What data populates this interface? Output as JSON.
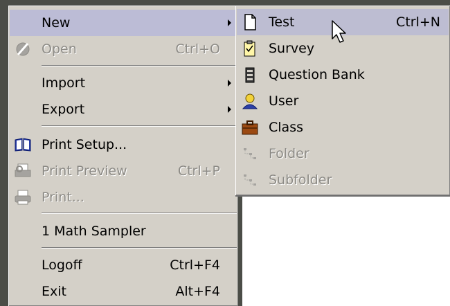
{
  "main_menu": {
    "new": {
      "label": "New"
    },
    "open": {
      "label": "Open",
      "shortcut": "Ctrl+O",
      "icon": "open-icon"
    },
    "import": {
      "label": "Import"
    },
    "export": {
      "label": "Export"
    },
    "print_setup": {
      "label": "Print Setup...",
      "icon": "book-icon"
    },
    "print_preview": {
      "label": "Print Preview",
      "shortcut": "Ctrl+P",
      "icon": "print-preview-icon"
    },
    "print": {
      "label": "Print...",
      "icon": "printer-icon"
    },
    "recent": {
      "label": "1 Math Sampler"
    },
    "logoff": {
      "label": "Logoff",
      "shortcut": "Ctrl+F4"
    },
    "exit": {
      "label": "Exit",
      "shortcut": "Alt+F4"
    }
  },
  "sub_menu": {
    "test": {
      "label": "Test",
      "shortcut": "Ctrl+N",
      "icon": "document-icon"
    },
    "survey": {
      "label": "Survey",
      "icon": "survey-icon"
    },
    "question_bank": {
      "label": "Question Bank",
      "icon": "question-bank-icon"
    },
    "user": {
      "label": "User",
      "icon": "user-icon"
    },
    "class": {
      "label": "Class",
      "icon": "briefcase-icon"
    },
    "folder": {
      "label": "Folder",
      "icon": "folder-tree-icon"
    },
    "subfolder": {
      "label": "Subfolder",
      "icon": "subfolder-tree-icon"
    }
  },
  "colors": {
    "menu_bg": "#d4d0c8",
    "highlight": "#bcbcd6",
    "disabled_text": "#8d8b86",
    "desktop_bg": "#4b4d47"
  }
}
